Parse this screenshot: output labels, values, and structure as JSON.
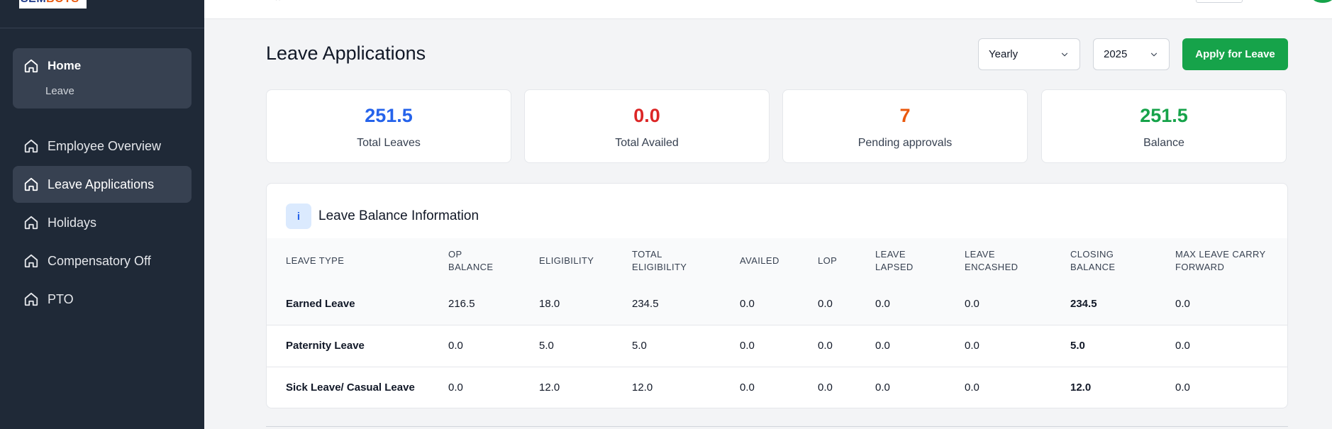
{
  "app": {
    "logo_text": "SEMBOTS"
  },
  "sidebar": {
    "home": {
      "label": "Home",
      "sub_item": "Leave"
    },
    "items": [
      {
        "label": "Employee Overview",
        "icon": "home-icon",
        "active": false
      },
      {
        "label": "Leave Applications",
        "icon": "home-icon",
        "active": true
      },
      {
        "label": "Holidays",
        "icon": "home-icon",
        "active": false
      },
      {
        "label": "Compensatory Off",
        "icon": "home-icon",
        "active": false
      },
      {
        "label": "PTO",
        "icon": "home-icon",
        "active": false
      }
    ]
  },
  "header": {
    "title": "Leave Applications"
  },
  "filters": {
    "period": {
      "value": "Yearly",
      "icon": "chevron-down-icon"
    },
    "year": {
      "value": "2025",
      "icon": "chevron-down-icon"
    }
  },
  "actions": {
    "apply_label": "Apply for Leave"
  },
  "stats": [
    {
      "value": "251.5",
      "label": "Total Leaves",
      "color": "#2563eb"
    },
    {
      "value": "0.0",
      "label": "Total Availed",
      "color": "#dc2626"
    },
    {
      "value": "7",
      "label": "Pending approvals",
      "color": "#ea580c"
    },
    {
      "value": "251.5",
      "label": "Balance",
      "color": "#16a34a"
    }
  ],
  "balance": {
    "badge": "i",
    "title": "Leave Balance Information",
    "columns": [
      "LEAVE TYPE",
      "OP BALANCE",
      "ELIGIBILITY",
      "TOTAL ELIGIBILITY",
      "AVAILED",
      "LOP",
      "LEAVE LAPSED",
      "LEAVE ENCASHED",
      "CLOSING BALANCE",
      "MAX LEAVE CARRY FORWARD"
    ],
    "rows": [
      [
        "Earned Leave",
        "216.5",
        "18.0",
        "234.5",
        "0.0",
        "0.0",
        "0.0",
        "0.0",
        "234.5",
        "0.0"
      ],
      [
        "Paternity Leave",
        "0.0",
        "5.0",
        "5.0",
        "0.0",
        "0.0",
        "0.0",
        "0.0",
        "5.0",
        "0.0"
      ],
      [
        "Sick Leave/ Casual Leave",
        "0.0",
        "12.0",
        "12.0",
        "0.0",
        "0.0",
        "0.0",
        "0.0",
        "12.0",
        "0.0"
      ]
    ]
  },
  "colors": {
    "sidebar_bg": "#1f2937",
    "accent_green": "#16a34a"
  }
}
